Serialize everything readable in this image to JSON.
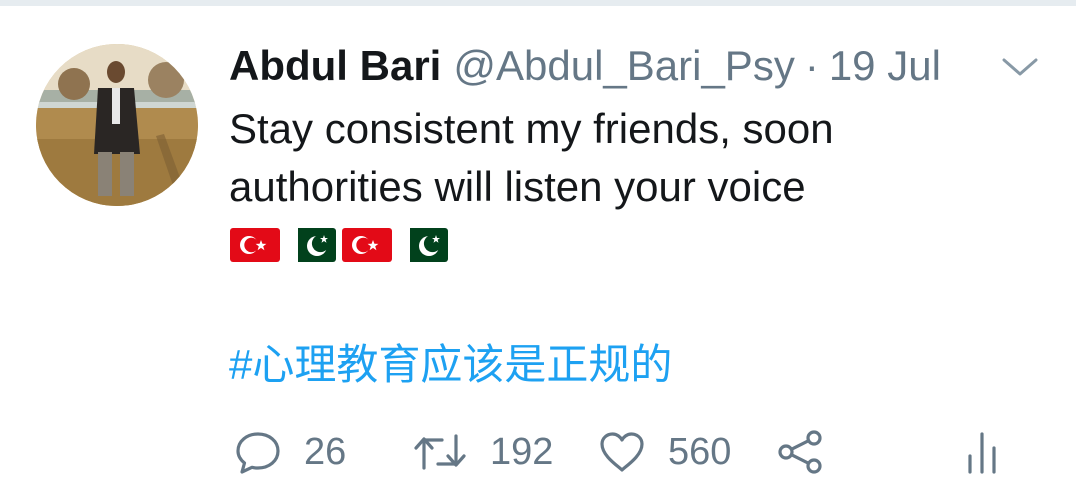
{
  "tweet": {
    "author_name": "Abdul Bari",
    "handle": "@Abdul_Bari_Psy",
    "separator": "·",
    "date": "19 Jul",
    "text": "Stay consistent my friends, soon authorities will listen your voice",
    "flags": [
      "turkey-flag",
      "pakistan-flag",
      "turkey-flag",
      "pakistan-flag"
    ],
    "hashtag": "#心理教育应该是正规的"
  },
  "actions": {
    "reply_count": "26",
    "retweet_count": "192",
    "like_count": "560"
  },
  "icons": {
    "reply": "reply-icon",
    "retweet": "retweet-icon",
    "like": "heart-icon",
    "share": "share-icon",
    "analytics": "analytics-icon",
    "menu": "chevron-down-icon"
  },
  "colors": {
    "name": "#14171a",
    "secondary": "#657786",
    "link": "#1da1f2",
    "divider": "#e6ecf0"
  }
}
